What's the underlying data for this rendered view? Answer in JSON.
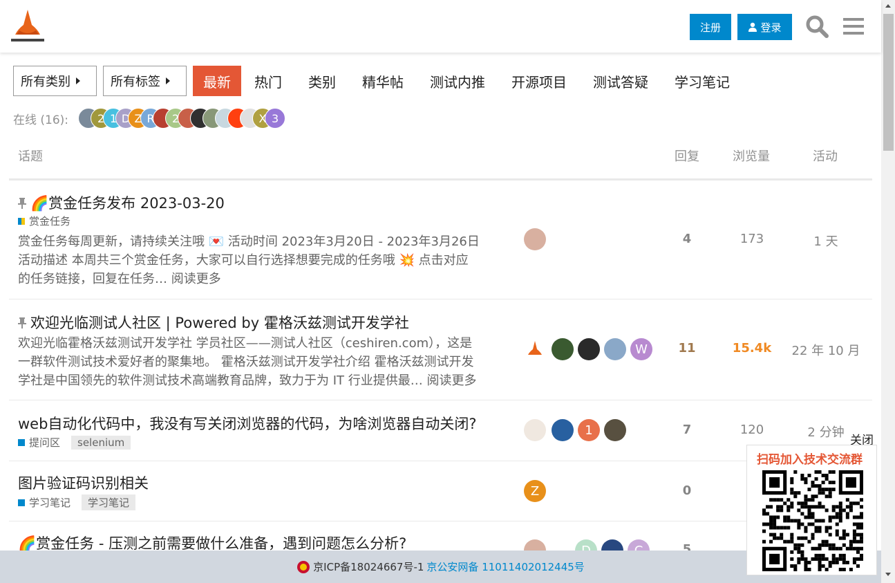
{
  "header": {
    "signup_label": "注册",
    "login_label": "登录",
    "logo_icon": "witch-hat-logo-icon",
    "search_icon": "search-icon",
    "menu_icon": "hamburger-menu-icon"
  },
  "nav": {
    "category_dropdown": "所有类别",
    "tag_dropdown": "所有标签",
    "tabs": [
      "最新",
      "热门",
      "类别",
      "精华帖",
      "测试内推",
      "开源项目",
      "测试答疑",
      "学习笔记"
    ],
    "active_tab": "最新"
  },
  "online": {
    "label": "在线 (16):",
    "avatars": [
      {
        "letter": "",
        "color": "#7a8a9a"
      },
      {
        "letter": "2",
        "color": "#a0983c"
      },
      {
        "letter": "1",
        "color": "#48c0e0"
      },
      {
        "letter": "D",
        "color": "#a8a0c8"
      },
      {
        "letter": "Z",
        "color": "#e8901a"
      },
      {
        "letter": "R",
        "color": "#78a8d8"
      },
      {
        "letter": "",
        "color": "#b84030"
      },
      {
        "letter": "2",
        "color": "#a8c888"
      },
      {
        "letter": "",
        "color": "#c86048"
      },
      {
        "letter": "",
        "color": "#303030"
      },
      {
        "letter": "",
        "color": "#889878"
      },
      {
        "letter": "",
        "color": "#c8d8e0"
      },
      {
        "letter": "",
        "color": "#ff4010"
      },
      {
        "letter": "",
        "color": "#e0e0e0"
      },
      {
        "letter": "X",
        "color": "#b0a040"
      },
      {
        "letter": "3",
        "color": "#9878d8"
      }
    ]
  },
  "table_header": {
    "topic": "话题",
    "replies": "回复",
    "views": "浏览量",
    "activity": "活动"
  },
  "topics": [
    {
      "emoji": "🌈",
      "title": "赏金任务发布 2023-03-20",
      "category": "赏金任务",
      "category_color": "#f1c40f",
      "excerpt_1": "赏金任务每周更新，请持续关注哦 💌 活动时间 2023年3月20日 - 2023年3月26日",
      "excerpt_2": "活动描述 本周共三个赏金任务，大家可以自行选择想要完成的任务哦 💥 点击对应",
      "excerpt_3": "的任务链接，回复在任务… 阅读更多",
      "replies": "4",
      "views": "173",
      "activity": "1 天"
    },
    {
      "title": "欢迎光临测试人社区 | Powered by 霍格沃兹测试开发学社",
      "excerpt_1": "欢迎光临霍格沃兹测试开发学社 学员社区——测试人社区（ceshiren.com），这是",
      "excerpt_2": "一群软件测试技术爱好者的聚集地。 霍格沃兹测试开发学社介绍 霍格沃兹测试开发",
      "excerpt_3": "学社是中国领先的软件测试技术高端教育品牌，致力于为 IT 行业提供最… 阅读更多",
      "replies": "11",
      "views": "15.4k",
      "activity": "22 年 10 月",
      "poster_letter": "W"
    },
    {
      "title": "web自动化代码中，我没有写关闭浏览器的代码，为啥浏览器自动关闭?",
      "category": "提问区",
      "category_color": "#0088cc",
      "tag": "selenium",
      "replies": "7",
      "views": "120",
      "activity": "2 分钟",
      "poster_letter": "1"
    },
    {
      "title": "图片验证码识别相关",
      "category": "学习笔记",
      "category_color": "#0088cc",
      "tag": "学习笔记",
      "replies": "0",
      "poster_letter": "Z"
    },
    {
      "emoji": "🌈",
      "title": "赏金任务 - 压测之前需要做什么准备，遇到问题怎么分析?",
      "replies": "5",
      "poster_letters": [
        "D",
        "C"
      ]
    }
  ],
  "footer": {
    "icp": "京ICP备18024667号-1",
    "police": "京公安网备 11011402012445号"
  },
  "qr_popup": {
    "close_label": "关闭",
    "title": "扫码加入技术交流群"
  }
}
